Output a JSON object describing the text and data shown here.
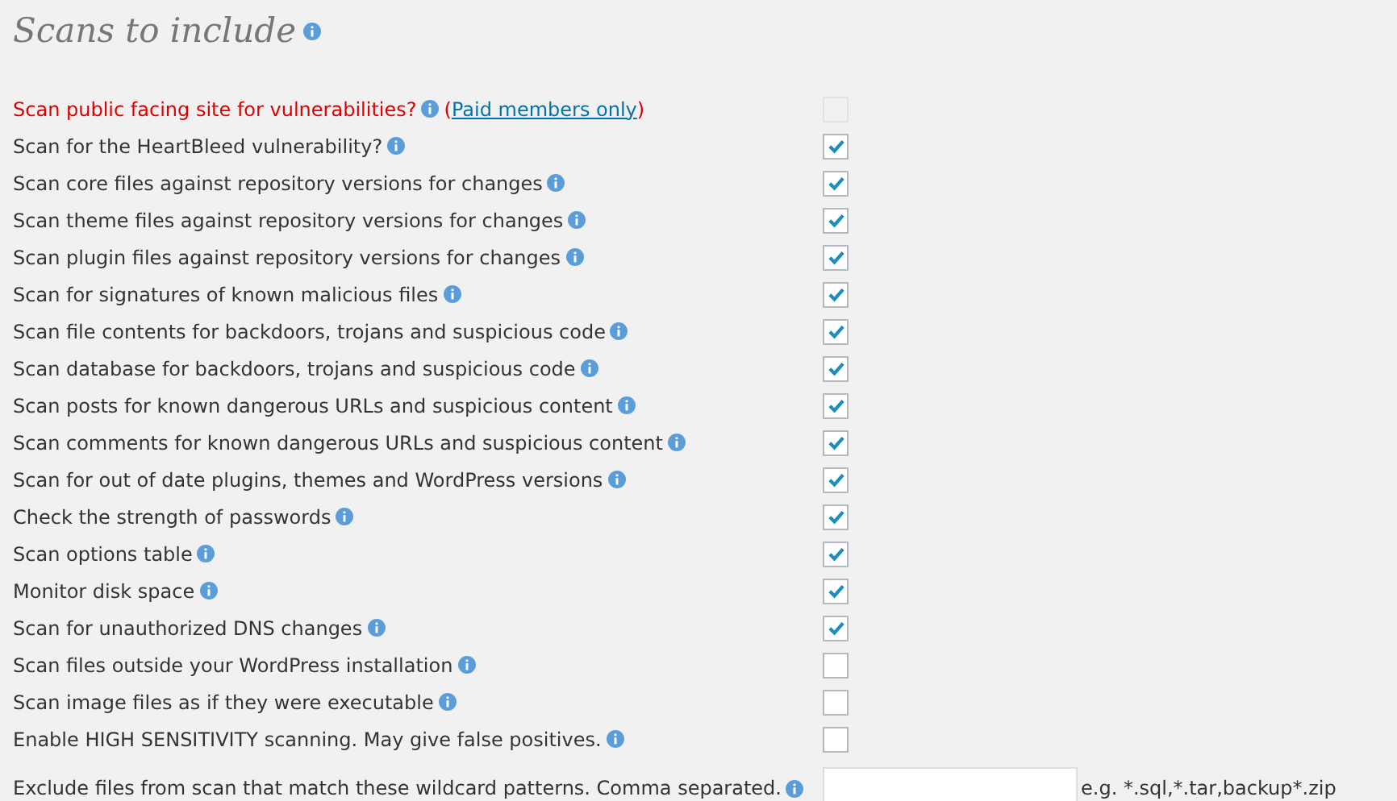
{
  "title": "Scans to include",
  "options": [
    {
      "kind": "paid",
      "label": "Scan public facing site for vulnerabilities?",
      "link": {
        "before": "(",
        "text": "Paid members only",
        "after": ")"
      },
      "checked": false,
      "disabled": true
    },
    {
      "kind": "option",
      "label": "Scan for the HeartBleed vulnerability?",
      "checked": true,
      "disabled": false
    },
    {
      "kind": "option",
      "label": "Scan core files against repository versions for changes",
      "checked": true,
      "disabled": false
    },
    {
      "kind": "option",
      "label": "Scan theme files against repository versions for changes",
      "checked": true,
      "disabled": false
    },
    {
      "kind": "option",
      "label": "Scan plugin files against repository versions for changes",
      "checked": true,
      "disabled": false
    },
    {
      "kind": "option",
      "label": "Scan for signatures of known malicious files",
      "checked": true,
      "disabled": false
    },
    {
      "kind": "option",
      "label": "Scan file contents for backdoors, trojans and suspicious code",
      "checked": true,
      "disabled": false
    },
    {
      "kind": "option",
      "label": "Scan database for backdoors, trojans and suspicious code",
      "checked": true,
      "disabled": false
    },
    {
      "kind": "option",
      "label": "Scan posts for known dangerous URLs and suspicious content",
      "checked": true,
      "disabled": false
    },
    {
      "kind": "option",
      "label": "Scan comments for known dangerous URLs and suspicious content",
      "checked": true,
      "disabled": false
    },
    {
      "kind": "option",
      "label": "Scan for out of date plugins, themes and WordPress versions",
      "checked": true,
      "disabled": false
    },
    {
      "kind": "option",
      "label": "Check the strength of passwords",
      "checked": true,
      "disabled": false
    },
    {
      "kind": "option",
      "label": "Scan options table",
      "checked": true,
      "disabled": false
    },
    {
      "kind": "option",
      "label": "Monitor disk space",
      "checked": true,
      "disabled": false
    },
    {
      "kind": "option",
      "label": "Scan for unauthorized DNS changes",
      "checked": true,
      "disabled": false
    },
    {
      "kind": "option",
      "label": "Scan files outside your WordPress installation",
      "checked": false,
      "disabled": false
    },
    {
      "kind": "option",
      "label": "Scan image files as if they were executable",
      "checked": false,
      "disabled": false
    },
    {
      "kind": "option",
      "label": "Enable HIGH SENSITIVITY scanning. May give false positives.",
      "checked": false,
      "disabled": false
    }
  ],
  "exclude": {
    "label": "Exclude files from scan that match these wildcard patterns. Comma separated.",
    "hint": "e.g. *.sql,*.tar,backup*.zip"
  }
}
